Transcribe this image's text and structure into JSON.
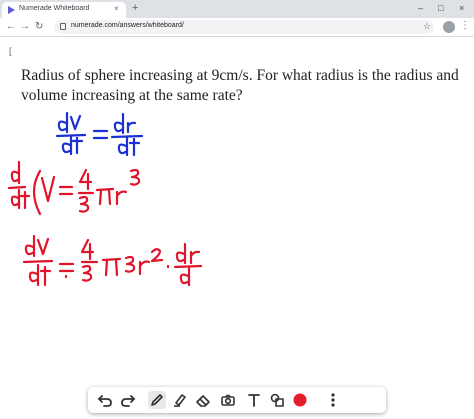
{
  "browser": {
    "tab_title": "Numerade Whiteboard",
    "tab_close": "×",
    "new_tab": "+",
    "url": "numerade.com/answers/whiteboard/",
    "window_minimize": "–",
    "window_maximize": "□",
    "window_close": "×"
  },
  "page": {
    "edge_glyph": "[",
    "problem_text": "Radius of sphere increasing at 9cm/s. For what radius is the radius and volume increasing at the same rate?"
  },
  "colors": {
    "blue_ink": "#1a2fd6",
    "red_ink": "#e0142a",
    "tool_red": "#e31e2b",
    "tool_dark": "#333333"
  },
  "palette": {
    "tools": [
      "undo-icon",
      "redo-icon",
      "pen-icon",
      "highlighter-icon",
      "eraser-icon",
      "camera-icon",
      "text-icon",
      "shape-icon",
      "color-red-swatch",
      "more-icon"
    ],
    "selected": "pen-icon"
  }
}
